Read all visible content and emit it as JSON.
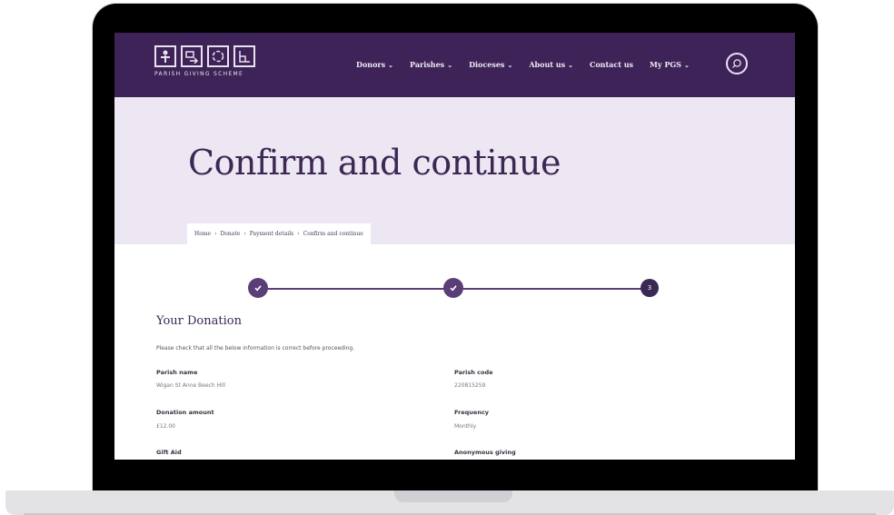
{
  "site": {
    "logo_text": "PARISH GIVING SCHEME",
    "nav": [
      {
        "label": "Donors"
      },
      {
        "label": "Parishes"
      },
      {
        "label": "Dioceses"
      },
      {
        "label": "About us"
      },
      {
        "label": "Contact us",
        "chevron": false
      },
      {
        "label": "My PGS"
      }
    ],
    "chevron": "⌄",
    "colors": {
      "header": "#3d2358",
      "hero": "#ede7f3",
      "accent": "#5a3e78"
    }
  },
  "page": {
    "title": "Confirm and continue",
    "breadcrumb": [
      "Home",
      "Donate",
      "Payment details",
      "Confirm and continue"
    ],
    "breadcrumb_sep": "›"
  },
  "progress": {
    "steps": [
      {
        "state": "complete",
        "icon": "check-icon"
      },
      {
        "state": "complete",
        "icon": "check-icon"
      },
      {
        "state": "current",
        "label": "3"
      }
    ]
  },
  "donation": {
    "heading": "Your Donation",
    "intro": "Please check that all the below information is correct before proceeding.",
    "fields": {
      "parish_name": {
        "label": "Parish name",
        "value": "Wigan St Anne Beech Hill"
      },
      "parish_code": {
        "label": "Parish code",
        "value": "220815259"
      },
      "donation_amount": {
        "label": "Donation amount",
        "value": "£12.00"
      },
      "frequency": {
        "label": "Frequency",
        "value": "Monthly"
      },
      "gift_aid": {
        "label": "Gift Aid"
      },
      "anonymous_giving": {
        "label": "Anonymous giving"
      }
    }
  }
}
